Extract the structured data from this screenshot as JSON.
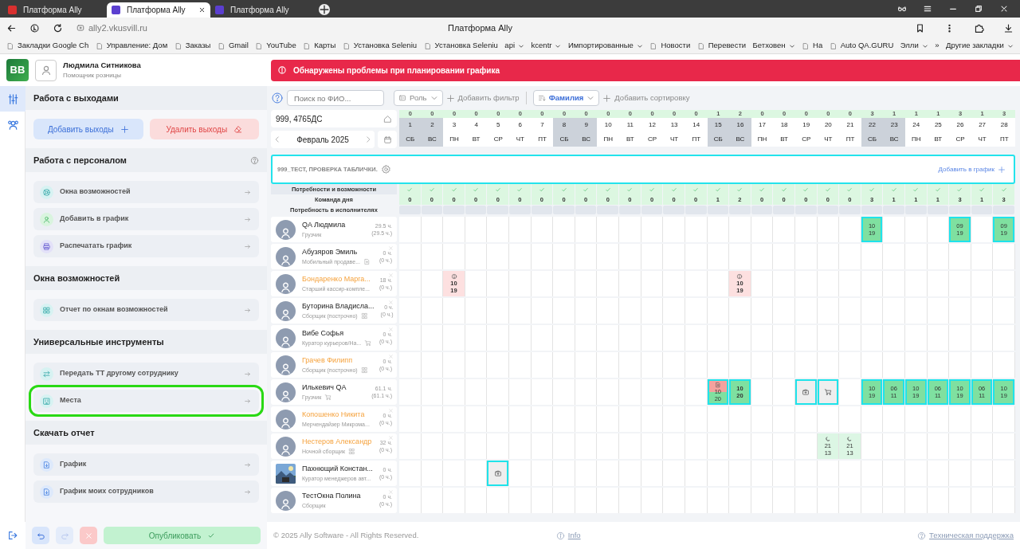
{
  "browser": {
    "tabs": [
      {
        "title": "Платформа Ally",
        "selected": false
      },
      {
        "title": "Платформа Ally",
        "selected": true
      },
      {
        "title": "Платформа Ally",
        "selected": false
      }
    ],
    "url": "ally2.vkusvill.ru",
    "page_title": "Платформа Ally",
    "bookmarks": [
      {
        "label": "Закладки Google Ch",
        "kind": "link"
      },
      {
        "label": "Управление: Дом",
        "kind": "link"
      },
      {
        "label": "Заказы",
        "kind": "link"
      },
      {
        "label": "Gmail",
        "kind": "link"
      },
      {
        "label": "YouTube",
        "kind": "link"
      },
      {
        "label": "Карты",
        "kind": "link"
      },
      {
        "label": "Установка Seleniu",
        "kind": "link"
      },
      {
        "label": "Установка Seleniu",
        "kind": "link"
      },
      {
        "label": "api",
        "kind": "folder"
      },
      {
        "label": "kcentr",
        "kind": "folder"
      },
      {
        "label": "Импортированные",
        "kind": "folder"
      },
      {
        "label": "Новости",
        "kind": "link"
      },
      {
        "label": "Перевести",
        "kind": "link"
      },
      {
        "label": "Бетховен",
        "kind": "folder"
      },
      {
        "label": "На",
        "kind": "link"
      },
      {
        "label": "Auto QA.GURU",
        "kind": "link"
      },
      {
        "label": "Элли",
        "kind": "folder"
      },
      {
        "label": "»",
        "kind": "more"
      },
      {
        "label": "Другие закладки",
        "kind": "folder"
      }
    ]
  },
  "app": {
    "logo": "BB",
    "user": {
      "name": "Людмила Ситникова",
      "role": "Помощник розницы"
    },
    "alert": "Обнаружены проблемы при планировании графика"
  },
  "rail": [
    {
      "kind": "tools",
      "selected": true
    },
    {
      "kind": "people",
      "selected": false
    }
  ],
  "sidebar": {
    "sections": [
      {
        "title": "Работа с выходами",
        "help": false,
        "buttons": [
          {
            "label": "Добавить выходы",
            "kind": "add"
          },
          {
            "label": "Удалить выходы",
            "kind": "delete"
          }
        ]
      },
      {
        "title": "Работа с персоналом",
        "help": true,
        "items": [
          {
            "label": "Окна возможностей",
            "kind": "lifebuoy",
            "highlighted": false
          },
          {
            "label": "Добавить в график",
            "kind": "person",
            "highlighted": false
          },
          {
            "label": "Распечатать график",
            "kind": "print",
            "highlighted": false
          }
        ]
      },
      {
        "title": "Окна возможностей",
        "help": false,
        "items": [
          {
            "label": "Отчет по окнам возможностей",
            "kind": "report",
            "highlighted": false
          }
        ]
      },
      {
        "title": "Универсальные инструменты",
        "help": false,
        "items": [
          {
            "label": "Передать ТТ другому сотруднику",
            "kind": "transfer",
            "highlighted": false
          },
          {
            "label": "Места",
            "kind": "building",
            "highlighted": true
          }
        ]
      },
      {
        "title": "Скачать отчет",
        "help": false,
        "items": [
          {
            "label": "График",
            "kind": "download",
            "highlighted": false
          },
          {
            "label": "График моих сотрудников",
            "kind": "download",
            "highlighted": false
          }
        ]
      }
    ],
    "actions": [
      {
        "kind": "undo",
        "disabled": false
      },
      {
        "kind": "redo",
        "disabled": true
      },
      {
        "kind": "cancel",
        "disabled": true
      }
    ],
    "publish": {
      "label": "Опубликовать",
      "disabled": true
    }
  },
  "toolbar": {
    "search_placeholder": "Поиск по ФИО...",
    "filters": [
      {
        "label": "Роль"
      }
    ],
    "add_filter": "Добавить фильтр",
    "sorts": [
      {
        "label": "Фамилия"
      }
    ],
    "add_sort": "Добавить сортировку"
  },
  "schedule": {
    "store": "999, 4765ДС",
    "month": "Февраль 2025",
    "team": "999_ТЕСТ, ПРОВЕРКА ТАБЛИЧКИ.",
    "add_to_schedule": "Добавить в график",
    "summary_rows": [
      {
        "label": "Потребности и возможности",
        "kind": "check"
      },
      {
        "label": "Команда дня",
        "kind": "count"
      },
      {
        "label": "Потребность в исполнителях",
        "kind": "blank"
      }
    ],
    "days": [
      {
        "day": "1",
        "dow": "СБ",
        "count": "0",
        "team": "0",
        "ok": true,
        "weekend": true
      },
      {
        "day": "2",
        "dow": "ВС",
        "count": "0",
        "team": "0",
        "ok": true,
        "weekend": true
      },
      {
        "day": "3",
        "dow": "ПН",
        "count": "0",
        "team": "0",
        "ok": true,
        "weekend": false
      },
      {
        "day": "4",
        "dow": "ВТ",
        "count": "0",
        "team": "0",
        "ok": true,
        "weekend": false
      },
      {
        "day": "5",
        "dow": "СР",
        "count": "0",
        "team": "0",
        "ok": true,
        "weekend": false
      },
      {
        "day": "6",
        "dow": "ЧТ",
        "count": "0",
        "team": "0",
        "ok": true,
        "weekend": false
      },
      {
        "day": "7",
        "dow": "ПТ",
        "count": "0",
        "team": "0",
        "ok": true,
        "weekend": false
      },
      {
        "day": "8",
        "dow": "СБ",
        "count": "0",
        "team": "0",
        "ok": true,
        "weekend": true
      },
      {
        "day": "9",
        "dow": "ВС",
        "count": "0",
        "team": "0",
        "ok": true,
        "weekend": true
      },
      {
        "day": "10",
        "dow": "ПН",
        "count": "0",
        "team": "0",
        "ok": true,
        "weekend": false
      },
      {
        "day": "11",
        "dow": "ВТ",
        "count": "0",
        "team": "0",
        "ok": true,
        "weekend": false
      },
      {
        "day": "12",
        "dow": "СР",
        "count": "0",
        "team": "0",
        "ok": true,
        "weekend": false
      },
      {
        "day": "13",
        "dow": "ЧТ",
        "count": "0",
        "team": "0",
        "ok": true,
        "weekend": false
      },
      {
        "day": "14",
        "dow": "ПТ",
        "count": "0",
        "team": "0",
        "ok": true,
        "weekend": false
      },
      {
        "day": "15",
        "dow": "СБ",
        "count": "1",
        "team": "1",
        "ok": true,
        "weekend": true
      },
      {
        "day": "16",
        "dow": "ВС",
        "count": "2",
        "team": "2",
        "ok": true,
        "weekend": true
      },
      {
        "day": "17",
        "dow": "ПН",
        "count": "0",
        "team": "0",
        "ok": true,
        "weekend": false
      },
      {
        "day": "18",
        "dow": "ВТ",
        "count": "0",
        "team": "0",
        "ok": true,
        "weekend": false
      },
      {
        "day": "19",
        "dow": "СР",
        "count": "0",
        "team": "0",
        "ok": true,
        "weekend": false
      },
      {
        "day": "20",
        "dow": "ЧТ",
        "count": "0",
        "team": "0",
        "ok": true,
        "weekend": false
      },
      {
        "day": "21",
        "dow": "ПТ",
        "count": "0",
        "team": "0",
        "ok": true,
        "weekend": false
      },
      {
        "day": "22",
        "dow": "СБ",
        "count": "3",
        "team": "3",
        "ok": true,
        "weekend": true
      },
      {
        "day": "23",
        "dow": "ВС",
        "count": "1",
        "team": "1",
        "ok": true,
        "weekend": true
      },
      {
        "day": "24",
        "dow": "ПН",
        "count": "1",
        "team": "1",
        "ok": true,
        "weekend": false
      },
      {
        "day": "25",
        "dow": "ВТ",
        "count": "1",
        "team": "1",
        "ok": true,
        "weekend": false
      },
      {
        "day": "26",
        "dow": "СР",
        "count": "3",
        "team": "3",
        "ok": true,
        "weekend": false
      },
      {
        "day": "27",
        "dow": "ЧТ",
        "count": "1",
        "team": "1",
        "ok": true,
        "weekend": false
      },
      {
        "day": "28",
        "dow": "ПТ",
        "count": "3",
        "team": "3",
        "ok": true,
        "weekend": false
      }
    ],
    "employees": [
      {
        "name": "QA Людмила",
        "role": "Грузчик",
        "hours": "29.5 ч.",
        "hours_total": "(29.5 ч.)",
        "flagged": false,
        "removable": false,
        "avatar": {
          "kind": "default"
        },
        "cells": [
          null,
          null,
          null,
          null,
          null,
          null,
          null,
          null,
          null,
          null,
          null,
          null,
          null,
          null,
          null,
          null,
          null,
          null,
          null,
          null,
          null,
          {
            "start": "10",
            "end": "19",
            "kind": "shift",
            "selected": true
          },
          null,
          null,
          null,
          {
            "start": "09",
            "end": "19",
            "kind": "shift",
            "selected": true
          },
          null,
          {
            "start": "09",
            "end": "19",
            "kind": "shift",
            "selected": true
          }
        ]
      },
      {
        "name": "Абузяров Эмиль",
        "role": "Мобильный продаве...",
        "badge": {
          "kind": "doc"
        },
        "hours": "0 ч.",
        "hours_total": "(0 ч.)",
        "flagged": false,
        "removable": true,
        "avatar": {
          "kind": "default"
        }
      },
      {
        "name": "Бондаренко Марга...",
        "role": "Старший кассир-компле...",
        "hours": "18 ч.",
        "hours_total": "(0 ч.)",
        "flagged": true,
        "removable": true,
        "avatar": {
          "kind": "default"
        },
        "cells": [
          null,
          null,
          {
            "start": "10",
            "end": "19",
            "kind": "pending",
            "selected": false
          },
          null,
          null,
          null,
          null,
          null,
          null,
          null,
          null,
          null,
          null,
          null,
          null,
          {
            "start": "10",
            "end": "19",
            "kind": "pending",
            "selected": false
          },
          null,
          null,
          null,
          null,
          null,
          null,
          null,
          null,
          null,
          null,
          null,
          null
        ]
      },
      {
        "name": "Буторина Владисла...",
        "role": "Сборщик (построчно)",
        "badge": {
          "kind": "grid"
        },
        "hours": "0 ч.",
        "hours_total": "(0 ч.)",
        "flagged": false,
        "removable": true,
        "avatar": {
          "kind": "default"
        }
      },
      {
        "name": "Вибе Софья",
        "role": "Куратор курьеров/На...",
        "badge": {
          "kind": "trolley"
        },
        "hours": "0 ч.",
        "hours_total": "(0 ч.)",
        "flagged": false,
        "removable": true,
        "avatar": {
          "kind": "default"
        }
      },
      {
        "name": "Грачев Филипп",
        "role": "Сборщик (построчно)",
        "badge": {
          "kind": "grid"
        },
        "hours": "0 ч.",
        "hours_total": "(0 ч.)",
        "flagged": true,
        "removable": true,
        "avatar": {
          "kind": "default"
        }
      },
      {
        "name": "Илькевич QA",
        "role": "Грузчик",
        "badge": {
          "kind": "trolley"
        },
        "hours": "61.1 ч.",
        "hours_total": "(61.1 ч.)",
        "flagged": false,
        "removable": false,
        "avatar": {
          "kind": "default"
        },
        "cells": [
          null,
          null,
          null,
          null,
          null,
          null,
          null,
          null,
          null,
          null,
          null,
          null,
          null,
          null,
          {
            "start": "10",
            "end": "20",
            "kind": "document",
            "selected": true
          },
          {
            "start": "10",
            "end": "20",
            "kind": "shift",
            "selected": true,
            "bold": true
          },
          null,
          null,
          {
            "kind": "sick",
            "selected": true
          },
          {
            "kind": "trolley",
            "selected": true
          },
          null,
          {
            "start": "10",
            "end": "19",
            "kind": "shift",
            "selected": true
          },
          {
            "start": "06",
            "end": "11",
            "kind": "shift",
            "selected": true
          },
          {
            "start": "10",
            "end": "19",
            "kind": "shift",
            "selected": true
          },
          {
            "start": "06",
            "end": "11",
            "kind": "shift",
            "selected": true
          },
          {
            "start": "10",
            "end": "19",
            "kind": "shift",
            "selected": true
          },
          {
            "start": "06",
            "end": "11",
            "kind": "shift",
            "selected": true
          },
          {
            "start": "10",
            "end": "19",
            "kind": "shift",
            "selected": true
          }
        ]
      },
      {
        "name": "Копошенко Никита",
        "role": "Мерчендайзер Микрома...",
        "hours": "0 ч.",
        "hours_total": "(0 ч.)",
        "flagged": true,
        "removable": true,
        "avatar": {
          "kind": "default"
        }
      },
      {
        "name": "Нестеров Александр",
        "role": "Ночной сборщик",
        "badge": {
          "kind": "grid"
        },
        "hours": "32 ч.",
        "hours_total": "(0 ч.)",
        "flagged": true,
        "removable": true,
        "avatar": {
          "kind": "default"
        },
        "cells": [
          null,
          null,
          null,
          null,
          null,
          null,
          null,
          null,
          null,
          null,
          null,
          null,
          null,
          null,
          null,
          null,
          null,
          null,
          null,
          {
            "start": "21",
            "end": "13",
            "kind": "night",
            "selected": false
          },
          {
            "start": "21",
            "end": "13",
            "kind": "night",
            "selected": false
          },
          null,
          null,
          null,
          null,
          null,
          null,
          null
        ]
      },
      {
        "name": "Пахнющий Констан...",
        "role": "Куратор менеджеров авт...",
        "hours": "0 ч.",
        "hours_total": "(0 ч.)",
        "flagged": false,
        "removable": false,
        "cells": [
          null,
          null,
          null,
          null,
          {
            "kind": "sick",
            "selected": true
          },
          null,
          null,
          null,
          null,
          null,
          null,
          null,
          null,
          null,
          null,
          null,
          null,
          null,
          null,
          null,
          null,
          null,
          null,
          null,
          null,
          null,
          null,
          null
        ]
      },
      {
        "name": "ТестОкна Полина",
        "role": "Сборщик",
        "hours": "0 ч.",
        "hours_total": "(0 ч.)",
        "flagged": false,
        "removable": true,
        "avatar": {
          "kind": "default"
        }
      }
    ]
  },
  "footer": {
    "copyright": "© 2025 Ally Software - All Rights Reserved.",
    "info": "Info",
    "support": "Техническая поддержка"
  }
}
